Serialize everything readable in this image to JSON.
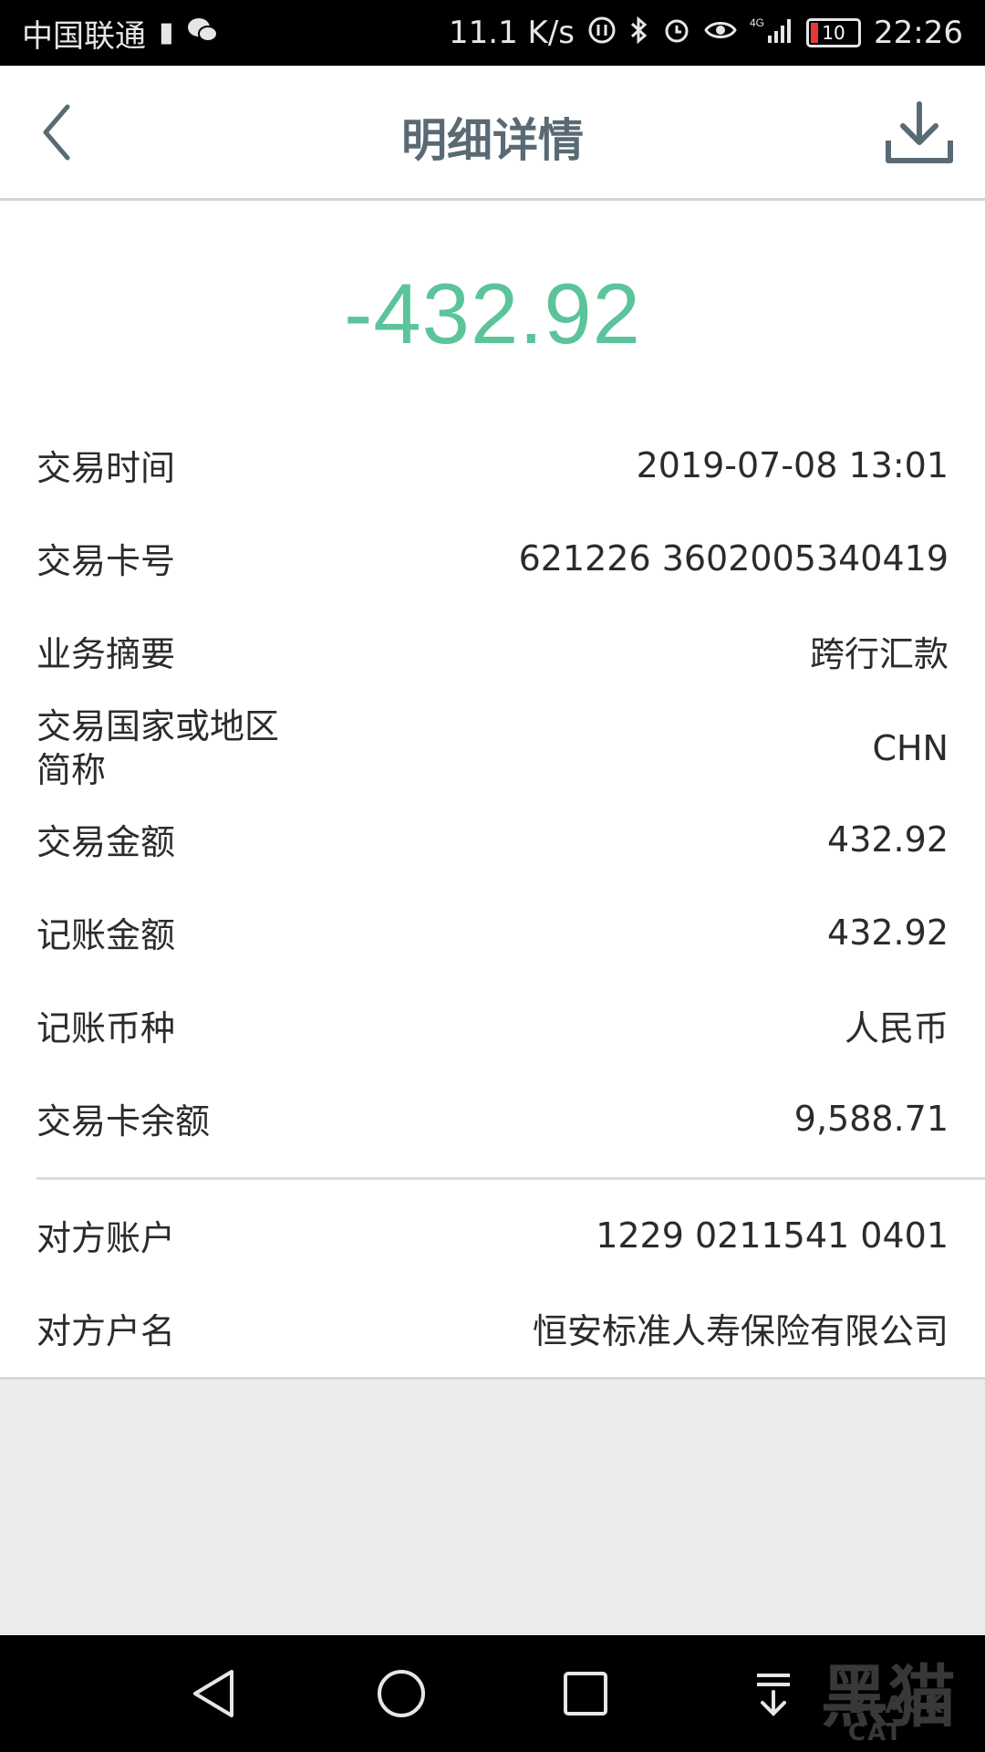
{
  "status_bar": {
    "carrier": "中国联通",
    "speed": "11.1 K/s",
    "network": "4G",
    "battery": "10",
    "time": "22:26"
  },
  "header": {
    "title": "明细详情",
    "back_icon": "chevron-left-icon",
    "download_icon": "download-icon"
  },
  "transaction": {
    "amount": "-432.92",
    "amount_color": "#5bc49a",
    "details": [
      {
        "label": "交易时间",
        "value": "2019-07-08 13:01"
      },
      {
        "label": "交易卡号",
        "value": "621226 3602005340419"
      },
      {
        "label": "业务摘要",
        "value": "跨行汇款"
      },
      {
        "label": "交易国家或地区简称",
        "label_line1": "交易国家或地区",
        "label_line2": "简称",
        "value": "CHN"
      },
      {
        "label": "交易金额",
        "value": "432.92"
      },
      {
        "label": "记账金额",
        "value": "432.92"
      },
      {
        "label": "记账币种",
        "value": "人民币"
      },
      {
        "label": "交易卡余额",
        "value": "9,588.71"
      }
    ],
    "counterparty": [
      {
        "label": "对方账户",
        "value": "1229 0211541 0401"
      },
      {
        "label": "对方户名",
        "value": "恒安标准人寿保险有限公司"
      }
    ]
  },
  "watermark": {
    "text": "黑猫",
    "sub": "BLACK CAT"
  }
}
